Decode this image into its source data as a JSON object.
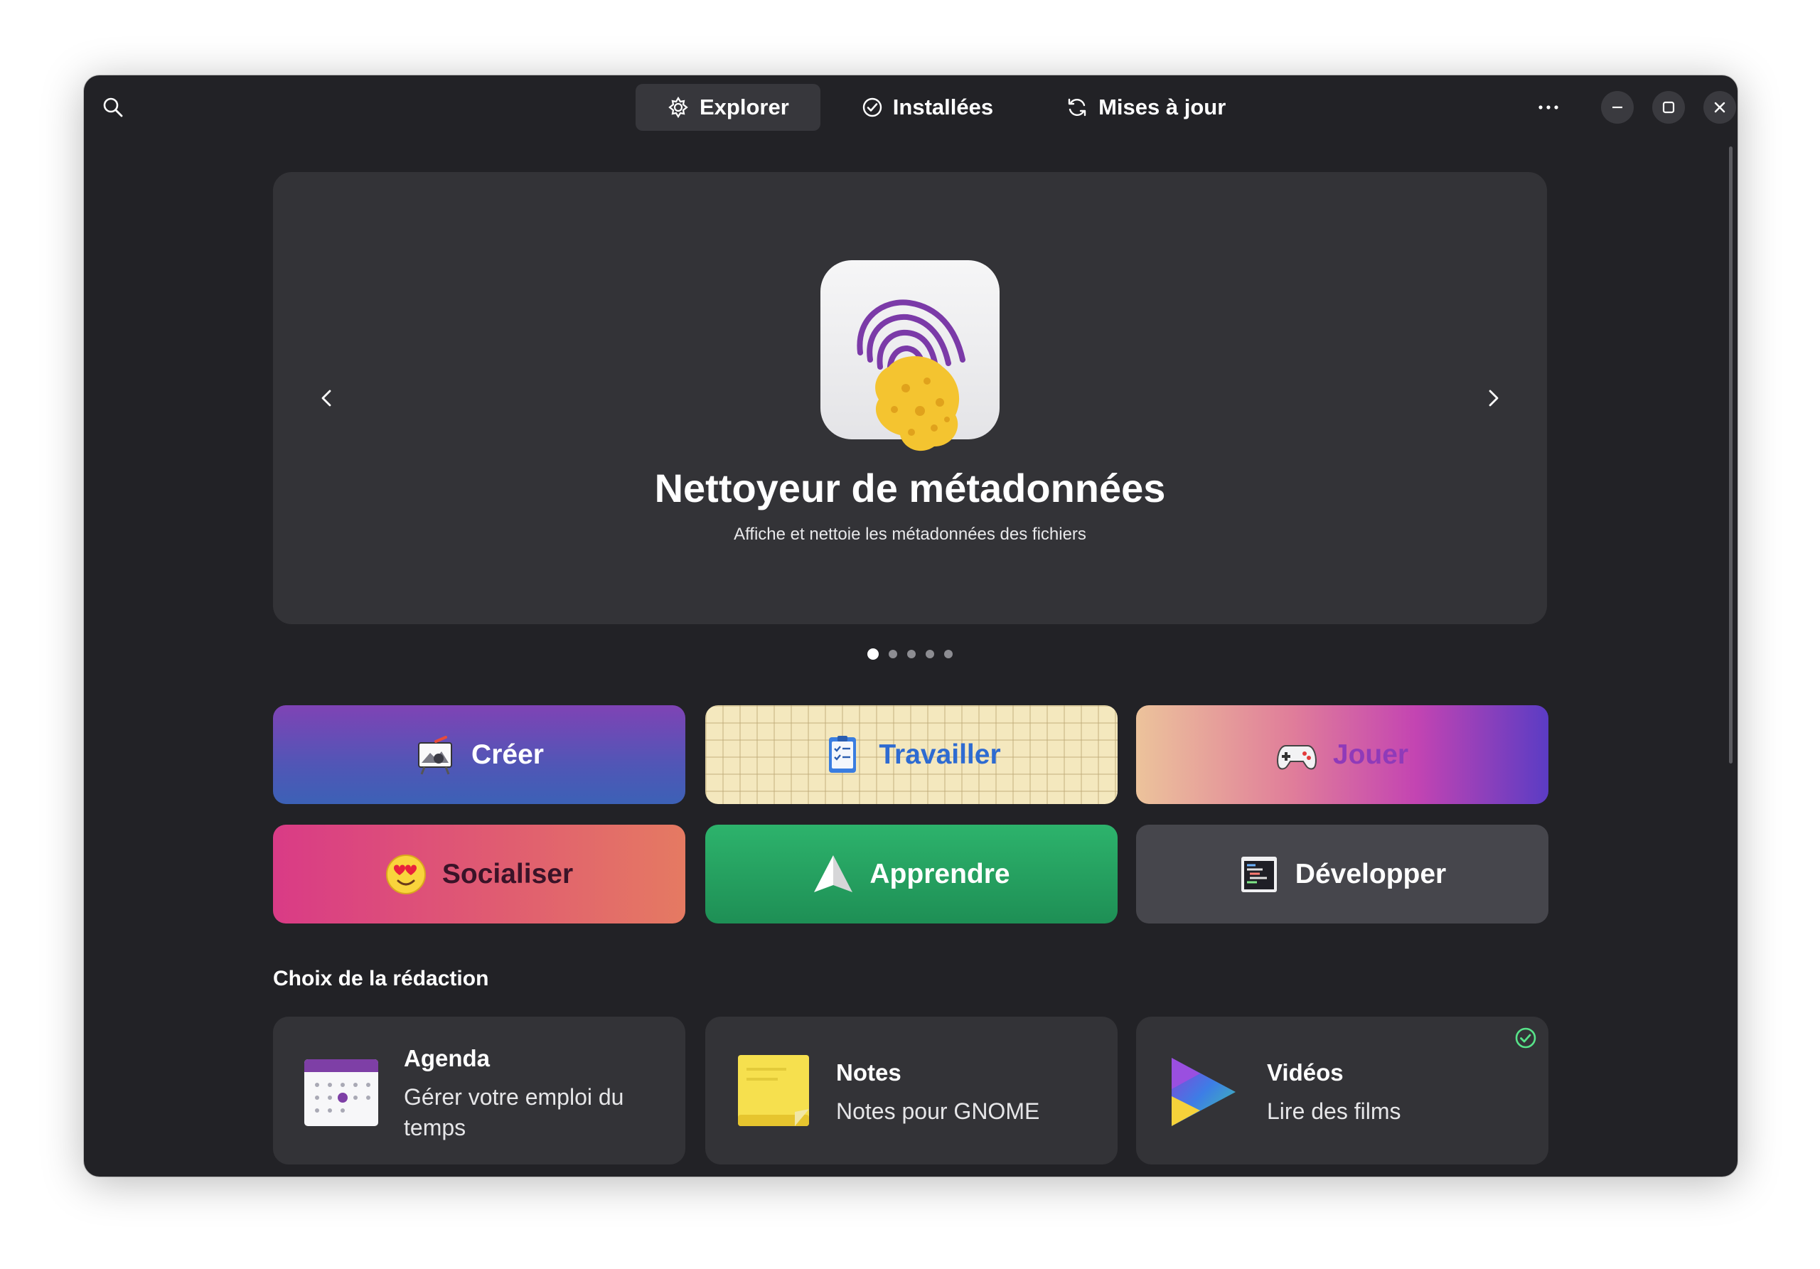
{
  "header": {
    "tabs": [
      {
        "label": "Explorer",
        "icon": "explore-icon",
        "active": true
      },
      {
        "label": "Installées",
        "icon": "check-circle-icon",
        "active": false
      },
      {
        "label": "Mises à jour",
        "icon": "refresh-icon",
        "active": false
      }
    ],
    "icons": {
      "search": "search-icon",
      "menu": "more-dots-icon",
      "minimize": "minimize-icon",
      "maximize": "maximize-icon",
      "close": "close-icon"
    }
  },
  "carousel": {
    "title": "Nettoyeur de métadonnées",
    "subtitle": "Affiche et nettoie les métadonnées des fichiers",
    "icon": "fingerprint-sponge-icon",
    "page_count": 5,
    "current_page": 1
  },
  "categories": [
    {
      "label": "Créer",
      "icon": "easel-icon",
      "color": "#5156b6"
    },
    {
      "label": "Travailler",
      "icon": "checklist-icon",
      "color": "#f4e8be"
    },
    {
      "label": "Jouer",
      "icon": "gamepad-icon",
      "color": "#c344b2"
    },
    {
      "label": "Socialiser",
      "icon": "heart-eyes-emoji-icon",
      "color": "#e05c71"
    },
    {
      "label": "Apprendre",
      "icon": "paper-plane-icon",
      "color": "#2db36c"
    },
    {
      "label": "Développer",
      "icon": "terminal-code-icon",
      "color": "#46464c"
    }
  ],
  "editors_choice": {
    "title": "Choix de la rédaction",
    "apps": [
      {
        "name": "Agenda",
        "description": "Gérer votre emploi du temps",
        "icon": "calendar-icon",
        "installed": false
      },
      {
        "name": "Notes",
        "description": "Notes pour GNOME",
        "icon": "sticky-note-icon",
        "installed": false
      },
      {
        "name": "Vidéos",
        "description": "Lire des films",
        "icon": "video-play-icon",
        "installed": true
      }
    ]
  },
  "colors": {
    "window_bg": "#222226",
    "card_bg": "#333337",
    "accent_installed": "#57e389"
  }
}
